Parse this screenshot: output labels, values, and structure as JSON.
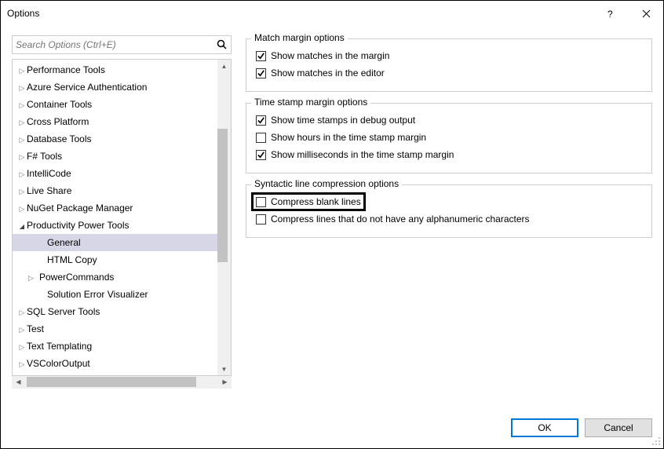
{
  "window": {
    "title": "Options"
  },
  "search": {
    "placeholder": "Search Options (Ctrl+E)"
  },
  "tree": {
    "items": [
      {
        "label": "Performance Tools",
        "caret": "right",
        "depth": 0
      },
      {
        "label": "Azure Service Authentication",
        "caret": "right",
        "depth": 0
      },
      {
        "label": "Container Tools",
        "caret": "right",
        "depth": 0
      },
      {
        "label": "Cross Platform",
        "caret": "right",
        "depth": 0
      },
      {
        "label": "Database Tools",
        "caret": "right",
        "depth": 0
      },
      {
        "label": "F# Tools",
        "caret": "right",
        "depth": 0
      },
      {
        "label": "IntelliCode",
        "caret": "right",
        "depth": 0
      },
      {
        "label": "Live Share",
        "caret": "right",
        "depth": 0
      },
      {
        "label": "NuGet Package Manager",
        "caret": "right",
        "depth": 0
      },
      {
        "label": "Productivity Power Tools",
        "caret": "down",
        "depth": 0
      },
      {
        "label": "General",
        "caret": "",
        "depth": 1,
        "selected": true
      },
      {
        "label": "HTML Copy",
        "caret": "",
        "depth": 1
      },
      {
        "label": "PowerCommands",
        "caret": "right",
        "depth": 1
      },
      {
        "label": "Solution Error Visualizer",
        "caret": "",
        "depth": 1
      },
      {
        "label": "SQL Server Tools",
        "caret": "right",
        "depth": 0
      },
      {
        "label": "Test",
        "caret": "right",
        "depth": 0
      },
      {
        "label": "Text Templating",
        "caret": "right",
        "depth": 0
      },
      {
        "label": "VSColorOutput",
        "caret": "right",
        "depth": 0
      }
    ]
  },
  "panels": {
    "match": {
      "title": "Match margin options",
      "items": [
        {
          "label": "Show matches in the margin",
          "checked": true
        },
        {
          "label": "Show matches in the editor",
          "checked": true
        }
      ]
    },
    "timestamp": {
      "title": "Time stamp margin options",
      "items": [
        {
          "label": "Show time stamps in debug output",
          "checked": true
        },
        {
          "label": "Show hours in the time stamp margin",
          "checked": false
        },
        {
          "label": "Show milliseconds in the time stamp margin",
          "checked": true
        }
      ]
    },
    "syntactic": {
      "title": "Syntactic line compression options",
      "items": [
        {
          "label": "Compress blank lines",
          "checked": false,
          "highlighted": true
        },
        {
          "label": "Compress lines that do not have any alphanumeric characters",
          "checked": false
        }
      ]
    }
  },
  "buttons": {
    "ok": "OK",
    "cancel": "Cancel"
  }
}
